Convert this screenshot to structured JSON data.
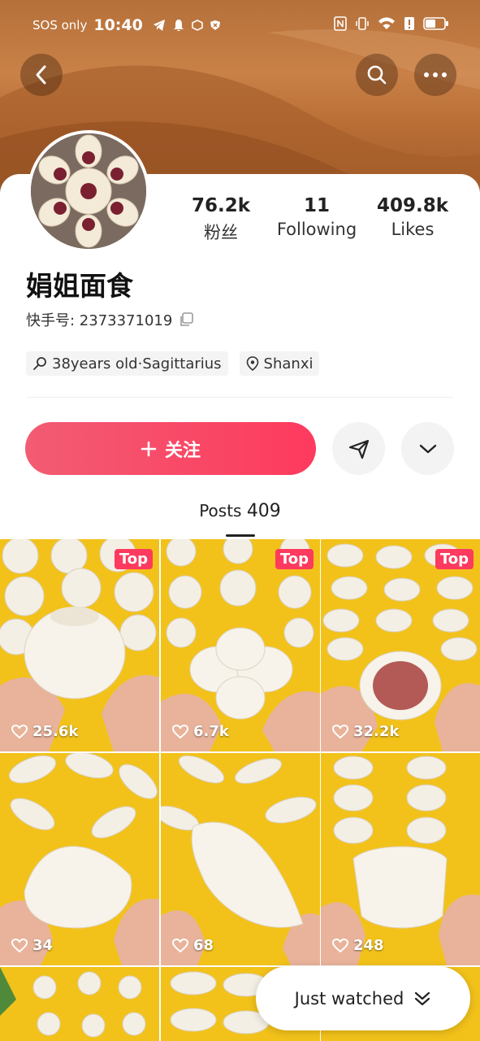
{
  "status_bar": {
    "carrier": "SOS only",
    "time": "10:40",
    "battery_level": 0.55
  },
  "profile": {
    "name": "娟姐面食",
    "user_id": "快手号: 2373371019",
    "stats": [
      {
        "value": "76.2k",
        "label": "粉丝"
      },
      {
        "value": "11",
        "label": "Following"
      },
      {
        "value": "409.8k",
        "label": "Likes"
      }
    ],
    "tags": [
      {
        "icon": "search-person-icon",
        "text": "38years old·Sagittarius"
      },
      {
        "icon": "location-pin-icon",
        "text": "Shanxi"
      }
    ]
  },
  "actions": {
    "follow_label": "关注",
    "follow_color": "#fe3a5e"
  },
  "posts_tab": {
    "label": "Posts",
    "count": "409"
  },
  "posts": [
    {
      "likes": "25.6k",
      "top": "Top"
    },
    {
      "likes": "6.7k",
      "top": "Top"
    },
    {
      "likes": "32.2k",
      "top": "Top"
    },
    {
      "likes": "34",
      "top": ""
    },
    {
      "likes": "68",
      "top": ""
    },
    {
      "likes": "248",
      "top": ""
    }
  ],
  "just_watched": "Just watched"
}
